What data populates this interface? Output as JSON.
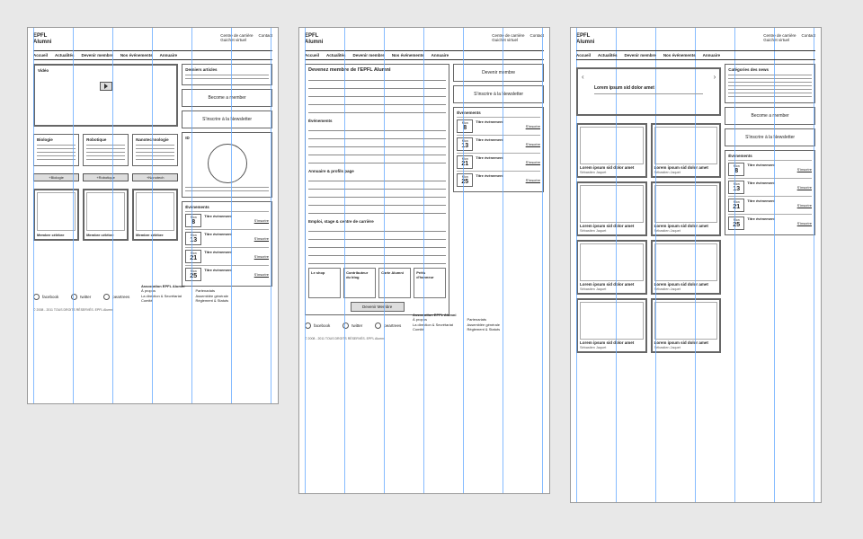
{
  "brand": {
    "l1": "EPFL",
    "l2": "Alumni"
  },
  "header": {
    "centre": "Centre de carrière",
    "guichet": "Guichet virtuel",
    "contact": "Contact"
  },
  "nav": [
    "Accueil",
    "Actualités",
    "Devenir membre",
    "Nos événements",
    "Annuaire"
  ],
  "ab1": {
    "video": "Vidéo",
    "derniers": "Derniers articles",
    "become": "Become a member",
    "newsletter": "S'inscrire à la Newsletter",
    "topics": [
      "Biologie",
      "Robotique",
      "Nanotechnologie"
    ],
    "id": "ID",
    "chips": [
      "+Biologie",
      "+Robotique",
      "+Nanotech"
    ],
    "events_title": "Événements",
    "member": "Membre célèbre"
  },
  "events": [
    {
      "mon": "Mon",
      "day": "8",
      "title": "Titre événement",
      "reg": "S'inscrire"
    },
    {
      "mon": "Mon",
      "day": "13",
      "title": "Titre événement",
      "reg": "S'inscrire"
    },
    {
      "mon": "Mon",
      "day": "21",
      "title": "Titre événement",
      "reg": "S'inscrire"
    },
    {
      "mon": "Mon",
      "day": "25",
      "title": "Titre événement",
      "reg": "S'inscrire"
    }
  ],
  "events3": [
    {
      "mon": "Mon",
      "day": "8",
      "title": "Titre événement",
      "reg": "S'inscrire"
    },
    {
      "mon": "Mon",
      "day": "13",
      "title": "Titre événement",
      "reg": "S'inscrire"
    },
    {
      "mon": "Mon",
      "day": "25",
      "title": "Titre événement",
      "reg": "S'inscrire"
    }
  ],
  "social": {
    "fb": "facebook",
    "tw": "twitter",
    "pt": "peartrees"
  },
  "footer": {
    "title": "Association EPFL Alumni",
    "c1": [
      "À propos",
      "La direction & Secrétariat",
      "Comité"
    ],
    "c2": [
      "Partenariats",
      "Assemblée générale",
      "Règlement & Statuts"
    ]
  },
  "copy": "© 2008 - 2011 TOUS DROITS RÉSERVÉS. EPFL Alumni",
  "ab2": {
    "form_title": "Devenez membre de l'EPFL Alumni",
    "devenir": "Devenir membre",
    "evt": "Événements",
    "annuaire": "Annuaire & profils page",
    "emploi": "Emploi, stage & centre de carrière",
    "mini": [
      "Le shop",
      "Contributeur du blog",
      "Carte Alumni",
      "Prêts d'honneur"
    ],
    "cta": "Devenir Membre"
  },
  "ab3": {
    "cat": "Catégories des news",
    "carousel_title": "Lorem ipsum sid dolor amet",
    "card_title": "Lorem ipsum sid dolor amet",
    "card_sub": "Sébastien Jaquet",
    "become": "Become a member",
    "newsletter": "S'inscrire à la Newsletter",
    "evt": "Événements"
  }
}
